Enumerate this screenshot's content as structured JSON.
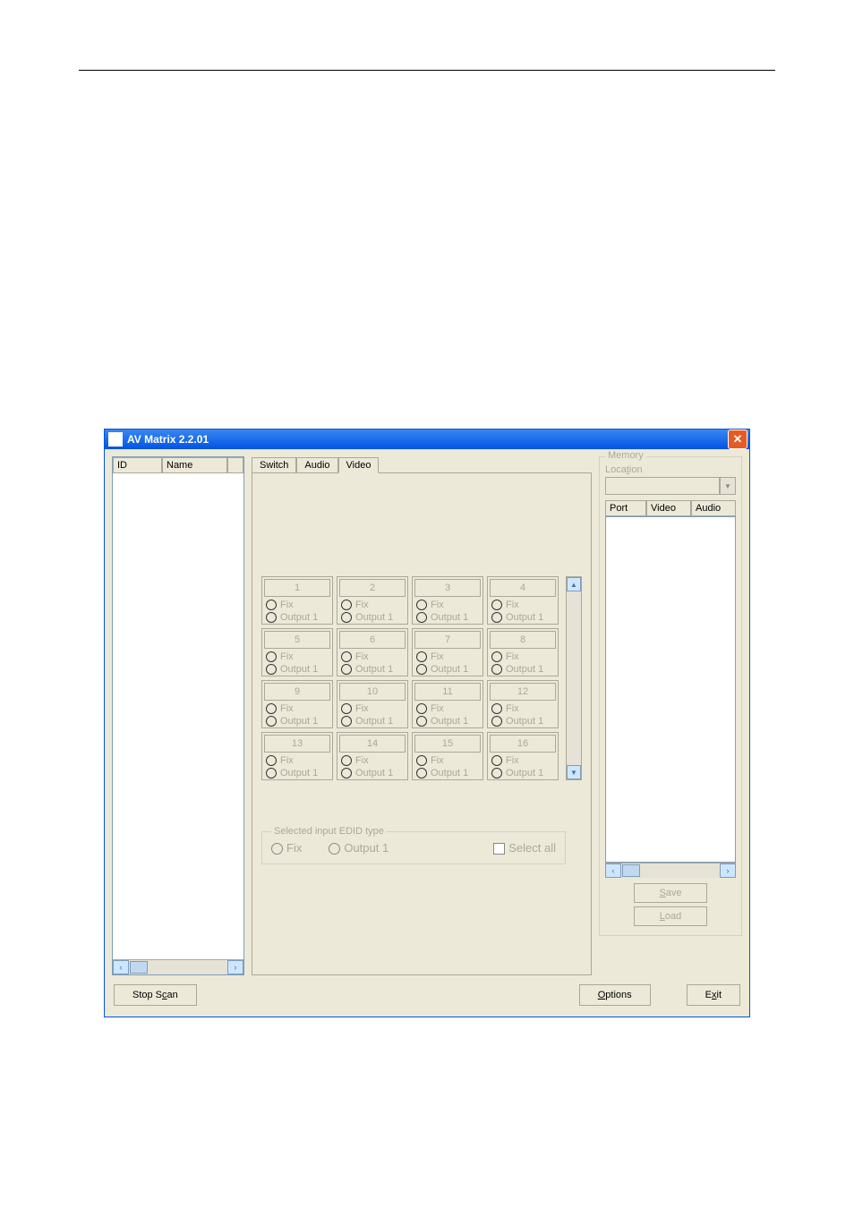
{
  "window": {
    "title": "AV Matrix 2.2.01"
  },
  "left": {
    "col_id": "ID",
    "col_name": "Name"
  },
  "tabs": {
    "switch": "Switch",
    "audio": "Audio",
    "video": "Video"
  },
  "inputs": {
    "fix_label": "Fix",
    "output_label": "Output 1",
    "cells": [
      "1",
      "2",
      "3",
      "4",
      "5",
      "6",
      "7",
      "8",
      "9",
      "10",
      "11",
      "12",
      "13",
      "14",
      "15",
      "16"
    ]
  },
  "edid": {
    "legend": "Selected input EDID type",
    "fix": "Fix",
    "output1": "Output 1",
    "select_all": "Select all"
  },
  "memory": {
    "legend": "Memory",
    "location": "Location",
    "col_port": "Port",
    "col_video": "Video",
    "col_audio": "Audio",
    "save": "Save",
    "load": "Load"
  },
  "bottom": {
    "stop_scan": "Stop Scan",
    "options": "Options",
    "exit": "Exit"
  }
}
